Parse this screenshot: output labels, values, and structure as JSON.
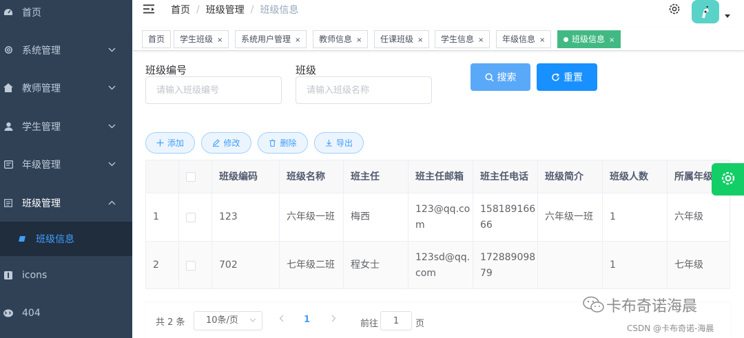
{
  "sidebar": {
    "items": [
      {
        "label": "首页",
        "icon": "dashboard-icon",
        "arrow": ""
      },
      {
        "label": "系统管理",
        "icon": "gear-icon",
        "arrow": "chevron-down"
      },
      {
        "label": "教师管理",
        "icon": "home-icon",
        "arrow": "chevron-down"
      },
      {
        "label": "学生管理",
        "icon": "user-icon",
        "arrow": "chevron-down"
      },
      {
        "label": "年级管理",
        "icon": "grade-icon",
        "arrow": "chevron-down"
      },
      {
        "label": "班级管理",
        "icon": "class-icon",
        "arrow": "chevron-up"
      },
      {
        "label": "icons",
        "icon": "icons-icon",
        "arrow": ""
      },
      {
        "label": "404",
        "icon": "404-icon",
        "arrow": ""
      }
    ],
    "submenu_active": "班级信息"
  },
  "navbar": {
    "breadcrumb": [
      "首页",
      "班级管理",
      "班级信息"
    ],
    "separator": "/"
  },
  "tags": [
    {
      "label": "首页",
      "closable": false
    },
    {
      "label": "学生班级",
      "closable": true
    },
    {
      "label": "系统用户管理",
      "closable": true
    },
    {
      "label": "教师信息",
      "closable": true
    },
    {
      "label": "任课班级",
      "closable": true
    },
    {
      "label": "学生信息",
      "closable": true
    },
    {
      "label": "年级信息",
      "closable": true
    },
    {
      "label": "班级信息",
      "closable": true,
      "active": true
    }
  ],
  "tag_close": "×",
  "search": {
    "code_label": "班级编号",
    "code_placeholder": "请输入班级编号",
    "name_label": "班级",
    "name_placeholder": "请输入班级名称",
    "search_btn": "搜索",
    "reset_btn": "重置"
  },
  "toolbar": {
    "add": "添加",
    "edit": "修改",
    "delete": "删除",
    "export": "导出"
  },
  "table": {
    "columns": [
      "",
      "",
      "班级编码",
      "班级名称",
      "班主任",
      "班主任邮箱",
      "班主任电话",
      "班级简介",
      "班级人数",
      "所属年级"
    ],
    "rows": [
      {
        "index": "1",
        "code": "123",
        "name": "六年级一班",
        "teacher": "梅西",
        "email_l1": "123@qq.co",
        "email_l2": "m",
        "phone_l1": "158189166",
        "phone_l2": "66",
        "intro": "六年级一班",
        "count": "1",
        "grade": "六年级"
      },
      {
        "index": "2",
        "code": "702",
        "name": "七年级二班",
        "teacher": "程女士",
        "email_l1": "123sd@qq.",
        "email_l2": "com",
        "phone_l1": "172889098",
        "phone_l2": "79",
        "intro": "",
        "count": "1",
        "grade": "七年级"
      }
    ]
  },
  "pagination": {
    "total": "共 2 条",
    "page_size": "10条/页",
    "current": "1",
    "goto_label": "前往",
    "goto_value": "1",
    "page_suffix": "页"
  },
  "watermark": {
    "main": "卡布奇诺海晨",
    "sub": "CSDN @卡布奇诺-海晨"
  },
  "colors": {
    "sidebar_bg": "#304156",
    "submenu_bg": "#1f2d3d",
    "primary": "#409eff",
    "tag_active": "#42b983",
    "float_setting": "#13ce66",
    "avatar": "#5ad2c8"
  }
}
